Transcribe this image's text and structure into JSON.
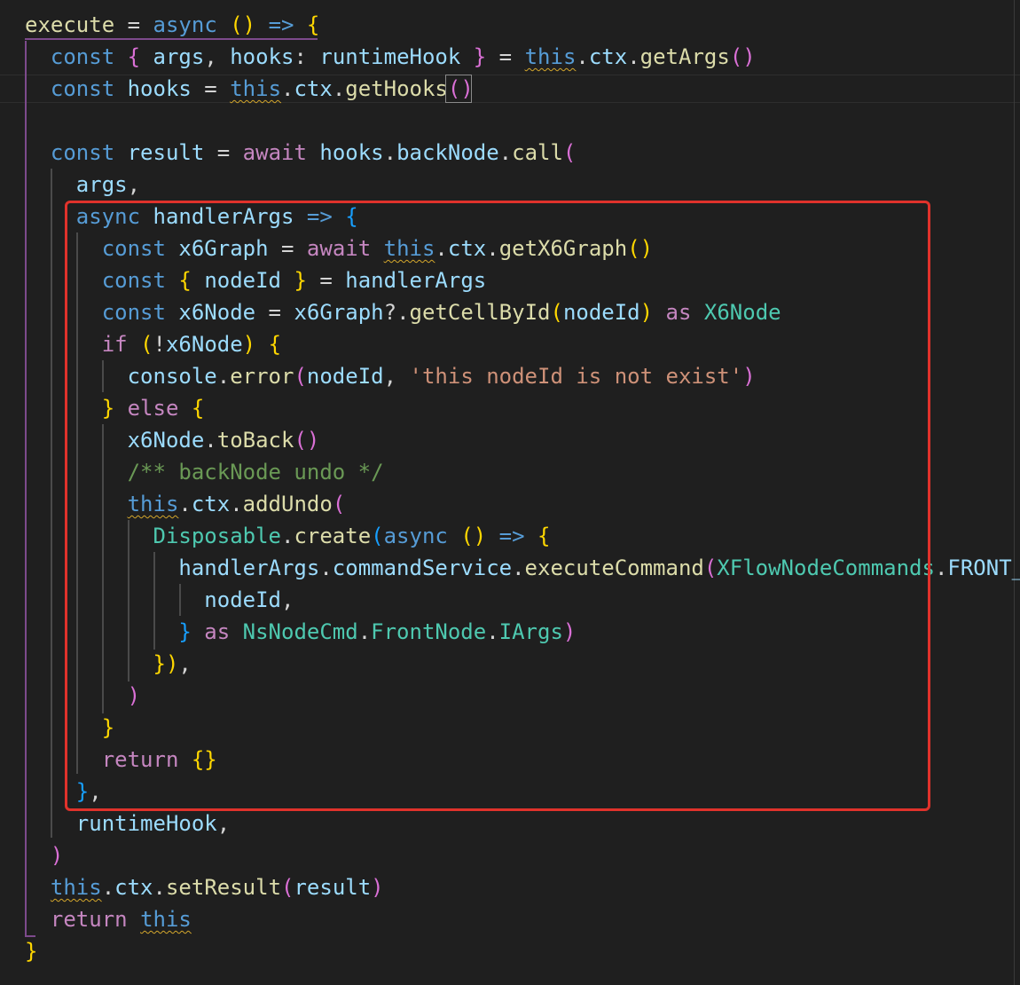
{
  "colors": {
    "background": "#1f1f1f",
    "highlight_box": "#e0322b",
    "keyword": "#569cd6",
    "control_keyword": "#c586c0",
    "variable": "#9cdcfe",
    "function": "#dcdcaa",
    "type": "#4ec9b0",
    "string": "#ce9178",
    "comment": "#6a9955",
    "bracket_gold": "#ffd700",
    "bracket_pink": "#da70d6",
    "bracket_blue": "#179fff",
    "squiggle": "#d4a72c",
    "guide_purple": "#7d4a8c"
  },
  "code": {
    "lines": [
      [
        [
          "execute",
          "fn"
        ],
        [
          " = ",
          "p"
        ],
        [
          "async",
          "kw"
        ],
        [
          " ",
          "p"
        ],
        [
          "()",
          "b1"
        ],
        [
          " => ",
          "kw"
        ],
        [
          "{",
          "b1"
        ]
      ],
      [
        [
          "  ",
          "p"
        ],
        [
          "const",
          "kw"
        ],
        [
          " ",
          "p"
        ],
        [
          "{",
          "b2"
        ],
        [
          " ",
          "p"
        ],
        [
          "args",
          "v"
        ],
        [
          ", ",
          "p"
        ],
        [
          "hooks",
          "v"
        ],
        [
          ": ",
          "p"
        ],
        [
          "runtimeHook",
          "v"
        ],
        [
          " ",
          "p"
        ],
        [
          "}",
          "b2"
        ],
        [
          " = ",
          "p"
        ],
        [
          "this",
          "kwsq"
        ],
        [
          ".",
          "p"
        ],
        [
          "ctx",
          "v"
        ],
        [
          ".",
          "p"
        ],
        [
          "getArgs",
          "fn"
        ],
        [
          "()",
          "b2"
        ]
      ],
      [
        [
          "  ",
          "p"
        ],
        [
          "const",
          "kw"
        ],
        [
          " ",
          "p"
        ],
        [
          "hooks",
          "v"
        ],
        [
          " = ",
          "p"
        ],
        [
          "this",
          "kwsq"
        ],
        [
          ".",
          "p"
        ],
        [
          "ctx",
          "v"
        ],
        [
          ".",
          "p"
        ],
        [
          "getHooks",
          "fn"
        ],
        [
          "()",
          "b2"
        ]
      ],
      [],
      [
        [
          "  ",
          "p"
        ],
        [
          "const",
          "kw"
        ],
        [
          " ",
          "p"
        ],
        [
          "result",
          "v"
        ],
        [
          " = ",
          "p"
        ],
        [
          "await",
          "ctl"
        ],
        [
          " ",
          "p"
        ],
        [
          "hooks",
          "v"
        ],
        [
          ".",
          "p"
        ],
        [
          "backNode",
          "v"
        ],
        [
          ".",
          "p"
        ],
        [
          "call",
          "fn"
        ],
        [
          "(",
          "b2"
        ]
      ],
      [
        [
          "    ",
          "p"
        ],
        [
          "args",
          "v"
        ],
        [
          ",",
          "p"
        ]
      ],
      [
        [
          "    ",
          "p"
        ],
        [
          "async",
          "kw"
        ],
        [
          " ",
          "p"
        ],
        [
          "handlerArgs",
          "v"
        ],
        [
          " => ",
          "kw"
        ],
        [
          "{",
          "b3"
        ]
      ],
      [
        [
          "      ",
          "p"
        ],
        [
          "const",
          "kw"
        ],
        [
          " ",
          "p"
        ],
        [
          "x6Graph",
          "v"
        ],
        [
          " = ",
          "p"
        ],
        [
          "await",
          "ctl"
        ],
        [
          " ",
          "p"
        ],
        [
          "this",
          "kwsq"
        ],
        [
          ".",
          "p"
        ],
        [
          "ctx",
          "v"
        ],
        [
          ".",
          "p"
        ],
        [
          "getX6Graph",
          "fn"
        ],
        [
          "()",
          "b1"
        ]
      ],
      [
        [
          "      ",
          "p"
        ],
        [
          "const",
          "kw"
        ],
        [
          " ",
          "p"
        ],
        [
          "{",
          "b1"
        ],
        [
          " ",
          "p"
        ],
        [
          "nodeId",
          "v"
        ],
        [
          " ",
          "p"
        ],
        [
          "}",
          "b1"
        ],
        [
          " = ",
          "p"
        ],
        [
          "handlerArgs",
          "v"
        ]
      ],
      [
        [
          "      ",
          "p"
        ],
        [
          "const",
          "kw"
        ],
        [
          " ",
          "p"
        ],
        [
          "x6Node",
          "v"
        ],
        [
          " = ",
          "p"
        ],
        [
          "x6Graph",
          "v"
        ],
        [
          "?.",
          "p"
        ],
        [
          "getCellById",
          "fn"
        ],
        [
          "(",
          "b1"
        ],
        [
          "nodeId",
          "v"
        ],
        [
          ")",
          "b1"
        ],
        [
          " ",
          "p"
        ],
        [
          "as",
          "ctl"
        ],
        [
          " ",
          "p"
        ],
        [
          "X6Node",
          "ty"
        ]
      ],
      [
        [
          "      ",
          "p"
        ],
        [
          "if",
          "ctl"
        ],
        [
          " ",
          "p"
        ],
        [
          "(",
          "b1"
        ],
        [
          "!",
          "p"
        ],
        [
          "x6Node",
          "v"
        ],
        [
          ")",
          "b1"
        ],
        [
          " ",
          "p"
        ],
        [
          "{",
          "b1"
        ]
      ],
      [
        [
          "        ",
          "p"
        ],
        [
          "console",
          "v"
        ],
        [
          ".",
          "p"
        ],
        [
          "error",
          "fn"
        ],
        [
          "(",
          "b2"
        ],
        [
          "nodeId",
          "v"
        ],
        [
          ", ",
          "p"
        ],
        [
          "'this nodeId is not exist'",
          "str"
        ],
        [
          ")",
          "b2"
        ]
      ],
      [
        [
          "      ",
          "p"
        ],
        [
          "}",
          "b1"
        ],
        [
          " ",
          "p"
        ],
        [
          "else",
          "ctl"
        ],
        [
          " ",
          "p"
        ],
        [
          "{",
          "b1"
        ]
      ],
      [
        [
          "        ",
          "p"
        ],
        [
          "x6Node",
          "v"
        ],
        [
          ".",
          "p"
        ],
        [
          "toBack",
          "fn"
        ],
        [
          "()",
          "b2"
        ]
      ],
      [
        [
          "        ",
          "p"
        ],
        [
          "/** backNode undo */",
          "cm"
        ]
      ],
      [
        [
          "        ",
          "p"
        ],
        [
          "this",
          "kwsq"
        ],
        [
          ".",
          "p"
        ],
        [
          "ctx",
          "v"
        ],
        [
          ".",
          "p"
        ],
        [
          "addUndo",
          "fn"
        ],
        [
          "(",
          "b2"
        ]
      ],
      [
        [
          "          ",
          "p"
        ],
        [
          "Disposable",
          "ty"
        ],
        [
          ".",
          "p"
        ],
        [
          "create",
          "fn"
        ],
        [
          "(",
          "b3"
        ],
        [
          "async",
          "kw"
        ],
        [
          " ",
          "p"
        ],
        [
          "()",
          "b1"
        ],
        [
          " => ",
          "kw"
        ],
        [
          "{",
          "b1"
        ]
      ],
      [
        [
          "            ",
          "p"
        ],
        [
          "handlerArgs",
          "v"
        ],
        [
          ".",
          "p"
        ],
        [
          "commandService",
          "v"
        ],
        [
          ".",
          "p"
        ],
        [
          "executeCommand",
          "fn"
        ],
        [
          "(",
          "b2"
        ],
        [
          "XFlowNodeCommands",
          "ty"
        ],
        [
          ".",
          "p"
        ],
        [
          "FRONT_NODE",
          "v"
        ]
      ],
      [
        [
          "              ",
          "p"
        ],
        [
          "nodeId",
          "v"
        ],
        [
          ",",
          "p"
        ]
      ],
      [
        [
          "            ",
          "p"
        ],
        [
          "}",
          "b3"
        ],
        [
          " ",
          "p"
        ],
        [
          "as",
          "ctl"
        ],
        [
          " ",
          "p"
        ],
        [
          "NsNodeCmd",
          "ty"
        ],
        [
          ".",
          "p"
        ],
        [
          "FrontNode",
          "ty"
        ],
        [
          ".",
          "p"
        ],
        [
          "IArgs",
          "ty"
        ],
        [
          ")",
          "b2"
        ]
      ],
      [
        [
          "          ",
          "p"
        ],
        [
          "})",
          "b1"
        ],
        [
          ",",
          "p"
        ]
      ],
      [
        [
          "        ",
          "p"
        ],
        [
          ")",
          "b2"
        ]
      ],
      [
        [
          "      ",
          "p"
        ],
        [
          "}",
          "b1"
        ]
      ],
      [
        [
          "      ",
          "p"
        ],
        [
          "return",
          "ctl"
        ],
        [
          " ",
          "p"
        ],
        [
          "{}",
          "b1"
        ]
      ],
      [
        [
          "    ",
          "p"
        ],
        [
          "}",
          "b3"
        ],
        [
          ",",
          "p"
        ]
      ],
      [
        [
          "    ",
          "p"
        ],
        [
          "runtimeHook",
          "v"
        ],
        [
          ",",
          "p"
        ]
      ],
      [
        [
          "  ",
          "p"
        ],
        [
          ")",
          "b2"
        ]
      ],
      [
        [
          "  ",
          "p"
        ],
        [
          "this",
          "kwsq"
        ],
        [
          ".",
          "p"
        ],
        [
          "ctx",
          "v"
        ],
        [
          ".",
          "p"
        ],
        [
          "setResult",
          "fn"
        ],
        [
          "(",
          "b2"
        ],
        [
          "result",
          "v"
        ],
        [
          ")",
          "b2"
        ]
      ],
      [
        [
          "  ",
          "p"
        ],
        [
          "return",
          "ctl"
        ],
        [
          " ",
          "p"
        ],
        [
          "this",
          "kwsq"
        ]
      ],
      [
        [
          "}",
          "b1"
        ]
      ]
    ]
  }
}
